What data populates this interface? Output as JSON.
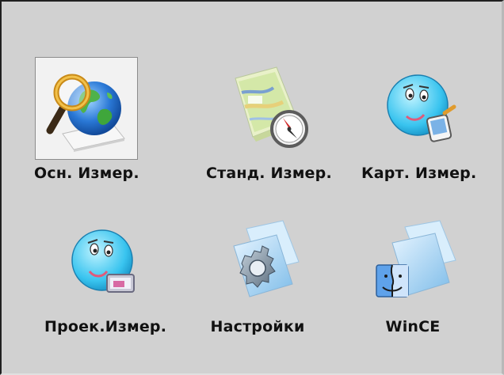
{
  "colors": {
    "background": "#d1d1d1",
    "selection_bg": "#f2f2f2",
    "label": "#111111"
  },
  "launchers": [
    {
      "label": "Осн. Измер.",
      "icon": "globe-magnifier-icon",
      "selected": true
    },
    {
      "label": "Станд. Измер.",
      "icon": "map-compass-icon",
      "selected": false
    },
    {
      "label": "Карт. Измер.",
      "icon": "smiley-device-icon",
      "selected": false
    },
    {
      "label": "Проек.Измер.",
      "icon": "smiley-projector-icon",
      "selected": false
    },
    {
      "label": "Настройки",
      "icon": "settings-gear-folder-icon",
      "selected": false
    },
    {
      "label": "WinCE",
      "icon": "finder-folder-icon",
      "selected": false
    }
  ]
}
